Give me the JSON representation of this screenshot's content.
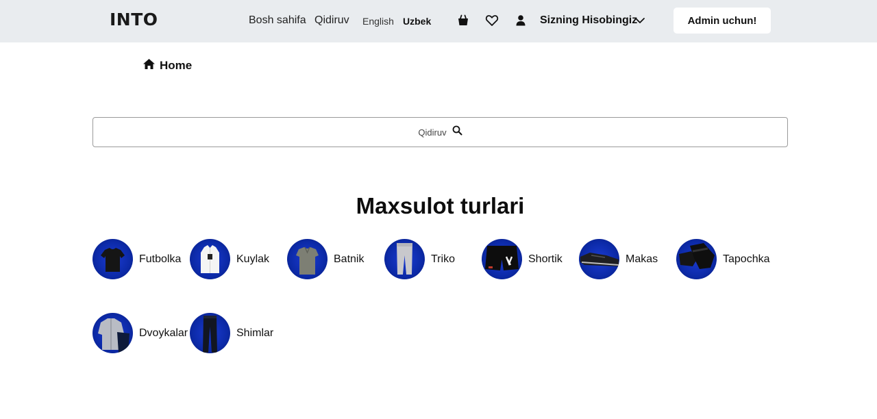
{
  "header": {
    "logo": "INTO",
    "nav": {
      "home": "Bosh sahifa",
      "search": "Qidiruv",
      "lang_en": "English",
      "lang_uz": "Uzbek"
    },
    "icons": [
      "basket-icon",
      "heart-icon",
      "user-icon"
    ],
    "account_label": "Sizning Hisobingiz",
    "admin_button": "Admin uchun!"
  },
  "breadcrumb": {
    "label": "Home"
  },
  "search": {
    "placeholder": "Qidiruv"
  },
  "categories_section": {
    "title": "Maxsulot turlari",
    "items": [
      {
        "name": "Futbolka"
      },
      {
        "name": "Kuylak"
      },
      {
        "name": "Batnik"
      },
      {
        "name": "Triko"
      },
      {
        "name": "Shortik"
      },
      {
        "name": "Makas"
      },
      {
        "name": "Tapochka"
      },
      {
        "name": "Dvoykalar"
      },
      {
        "name": "Shimlar"
      }
    ]
  },
  "colors": {
    "header_bg": "#e9ecef",
    "thumb_blue": "#0c2aa8"
  }
}
